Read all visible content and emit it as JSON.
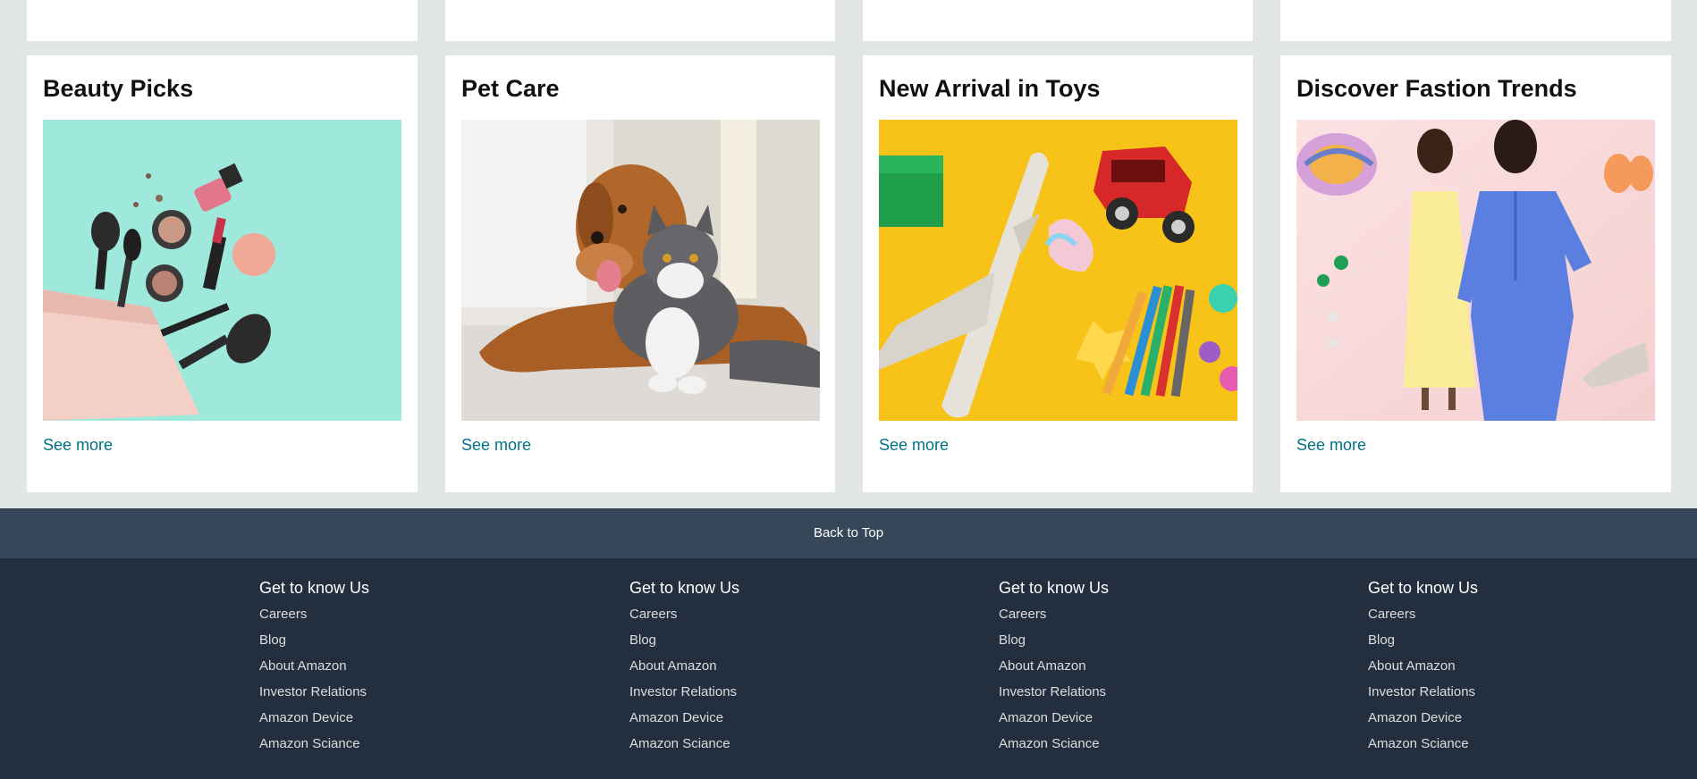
{
  "cards": [
    {
      "title": "Beauty Picks",
      "image": "beauty-products-image",
      "see_more": "See more"
    },
    {
      "title": "Pet Care",
      "image": "dog-and-cat-image",
      "see_more": "See more"
    },
    {
      "title": "New Arrival in Toys",
      "image": "toys-image",
      "see_more": "See more"
    },
    {
      "title": "Discover Fastion Trends",
      "image": "fashion-models-image",
      "see_more": "See more"
    }
  ],
  "back_to_top": "Back to Top",
  "footer": {
    "columns": [
      {
        "heading": "Get to know Us",
        "links": [
          "Careers",
          "Blog",
          "About Amazon",
          "Investor Relations",
          "Amazon Device",
          "Amazon Sciance"
        ]
      },
      {
        "heading": "Get to know Us",
        "links": [
          "Careers",
          "Blog",
          "About Amazon",
          "Investor Relations",
          "Amazon Device",
          "Amazon Sciance"
        ]
      },
      {
        "heading": "Get to know Us",
        "links": [
          "Careers",
          "Blog",
          "About Amazon",
          "Investor Relations",
          "Amazon Device",
          "Amazon Sciance"
        ]
      },
      {
        "heading": "Get to know Us",
        "links": [
          "Careers",
          "Blog",
          "About Amazon",
          "Investor Relations",
          "Amazon Device",
          "Amazon Sciance"
        ]
      }
    ]
  },
  "colors": {
    "page_bg": "#e3e6e6",
    "link": "#007185",
    "back_to_top_bg": "#37475a",
    "footer_bg": "#232f3e"
  }
}
